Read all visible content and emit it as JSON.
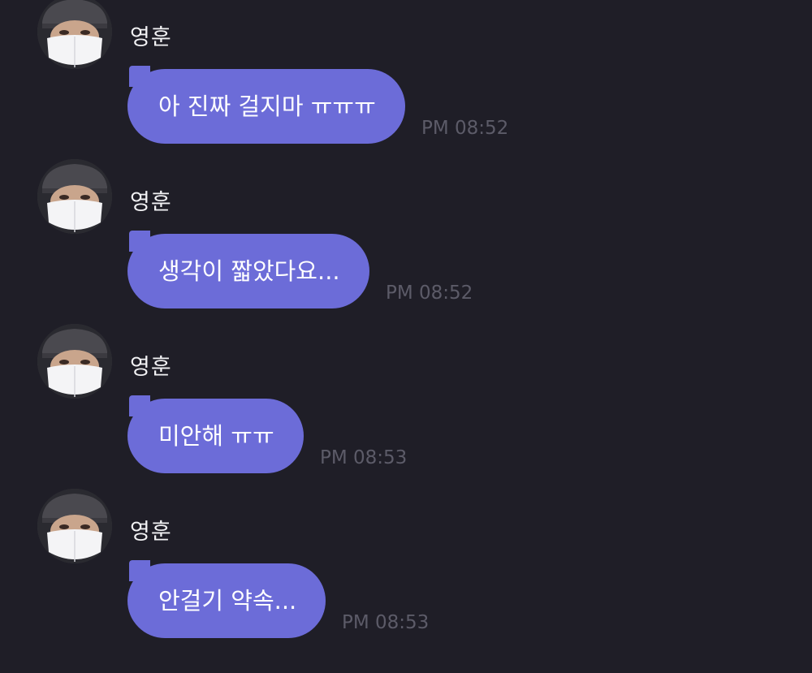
{
  "messages": [
    {
      "sender": "영훈",
      "text": "아 진짜 걸지마 ㅠㅠㅠ",
      "time": "PM 08:52"
    },
    {
      "sender": "영훈",
      "text": "생각이 짧았다요...",
      "time": "PM 08:52"
    },
    {
      "sender": "영훈",
      "text": "미안해 ㅠㅠ",
      "time": "PM 08:53"
    },
    {
      "sender": "영훈",
      "text": "안걸기 약속...",
      "time": "PM 08:53"
    }
  ],
  "colors": {
    "background": "#1f1e27",
    "bubble": "#6c6cd8",
    "bubble_text": "#ffffff",
    "sender_text": "#f2f2f4",
    "time_text": "#5c5b68"
  },
  "icons": {
    "avatar": "profile-photo-avatar-icon"
  }
}
